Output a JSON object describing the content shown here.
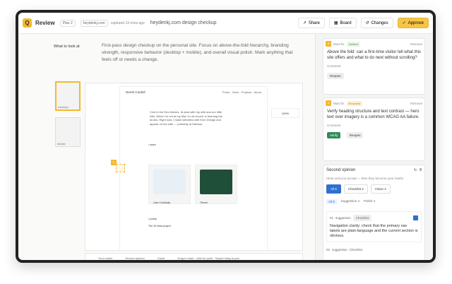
{
  "header": {
    "app": "Review",
    "plan": "Plan 2",
    "domain": "heydenkj.com",
    "captured": "captured 13 mins ago",
    "page_title": "heydenkj.com design checkup",
    "share": "Share",
    "board": "Board",
    "changes": "Changes",
    "approve": "Approve"
  },
  "brief": {
    "label": "What to look at",
    "text": "First-pass design checkup on the personal site. Focus on above-the-fold hierarchy, branding strength, responsive behavior (desktop + mobile), and overall visual polish. Mark anything that feels off or needs a change."
  },
  "thumbs": [
    "Desktop",
    "Mobile"
  ],
  "site": {
    "name": "Derek Cardell",
    "nav": [
      "Photo",
      "Work",
      "Projects",
      "About"
    ],
    "text": "I live in the Des Moines, IA area with my wife and our little kids. When I'm not at my Mac I'm at church or learning the drums. Right now, I make websites with Kern Design and appear on the side — primarily at Harbour.",
    "section1": "/ work",
    "card1": "Care Continuity",
    "card2": "Throne",
    "section2": "/ posts",
    "post": "The 49 mess project"
  },
  "zoom": "100%",
  "legend": [
    "Your marks",
    "Second opinion",
    "Guest",
    "Drag to mark · click for point · Space+drag to pan"
  ],
  "issues": [
    {
      "num": "3",
      "label": "Must fix",
      "status": "Verified",
      "action": "Remove",
      "text": "Above the fold: can a first-time visitor tell what this site offers and what to do next without scrolling?",
      "comment": "Comment",
      "buttons": [
        "Reopen"
      ]
    },
    {
      "num": "4",
      "label": "Must fix",
      "status": "Resolved",
      "action": "Remove",
      "text": "Verify heading structure and text contrast — hero text over imagery is a common WCAG AA failure.",
      "comment": "Comment",
      "buttons": [
        "Verify",
        "Reopen"
      ]
    }
  ],
  "second": {
    "title": "Second opinion",
    "count": "8",
    "note": "Hints until you accept — then they become your marks",
    "tabs": [
      "All 8",
      "Checklist 4",
      "Vision 4"
    ],
    "subtabs": [
      "All 8",
      "Suggestion 4",
      "Polish 4"
    ],
    "item": {
      "num": "01",
      "type": "suggestion",
      "tag": "Checklist",
      "text": "Navigation clarity: check that the primary nav labels are plain-language and the current section is obvious."
    },
    "next": {
      "num": "02",
      "type": "suggestion",
      "tag": "Checklist"
    }
  }
}
